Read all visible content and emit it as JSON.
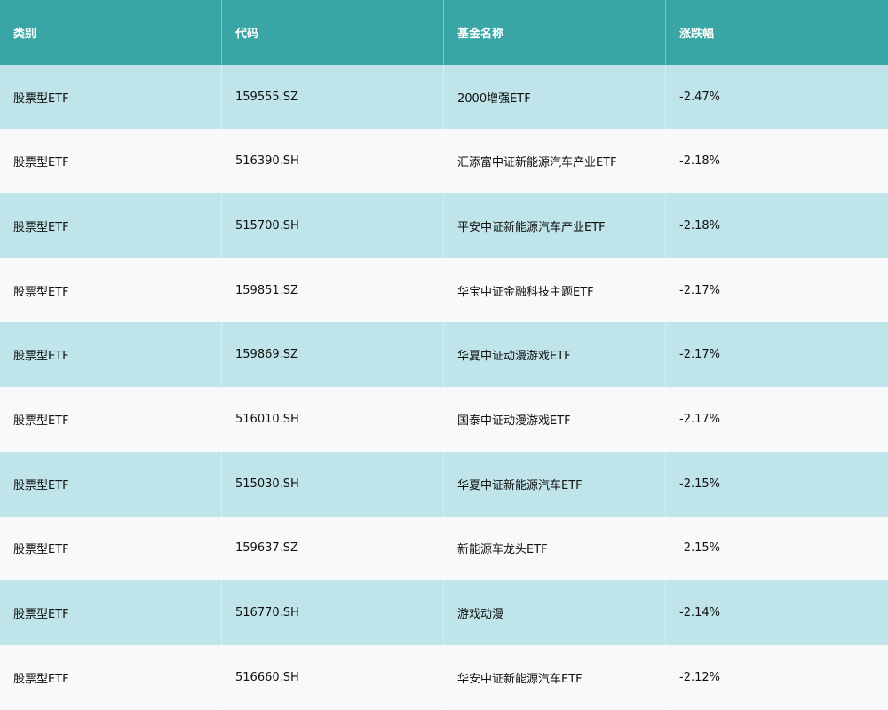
{
  "table": {
    "headers": [
      "类别",
      "代码",
      "基金名称",
      "涨跌幅"
    ],
    "rows": [
      {
        "category": "股票型ETF",
        "code": "159555.SZ",
        "name": "2000增强ETF",
        "change": "-2.47%"
      },
      {
        "category": "股票型ETF",
        "code": "516390.SH",
        "name": "汇添富中证新能源汽车产业ETF",
        "change": "-2.18%"
      },
      {
        "category": "股票型ETF",
        "code": "515700.SH",
        "name": "平安中证新能源汽车产业ETF",
        "change": "-2.18%"
      },
      {
        "category": "股票型ETF",
        "code": "159851.SZ",
        "name": "华宝中证金融科技主题ETF",
        "change": "-2.17%"
      },
      {
        "category": "股票型ETF",
        "code": "159869.SZ",
        "name": "华夏中证动漫游戏ETF",
        "change": "-2.17%"
      },
      {
        "category": "股票型ETF",
        "code": "516010.SH",
        "name": "国泰中证动漫游戏ETF",
        "change": "-2.17%"
      },
      {
        "category": "股票型ETF",
        "code": "515030.SH",
        "name": "华夏中证新能源汽车ETF",
        "change": "-2.15%"
      },
      {
        "category": "股票型ETF",
        "code": "159637.SZ",
        "name": "新能源车龙头ETF",
        "change": "-2.15%"
      },
      {
        "category": "股票型ETF",
        "code": "516770.SH",
        "name": "游戏动漫",
        "change": "-2.14%"
      },
      {
        "category": "股票型ETF",
        "code": "516660.SH",
        "name": "华安中证新能源汽车ETF",
        "change": "-2.12%"
      }
    ]
  },
  "colors": {
    "header_bg": "#3aa5a5",
    "row_odd_bg": "#bfe4e9",
    "row_even_bg": "#f7f9fb"
  }
}
